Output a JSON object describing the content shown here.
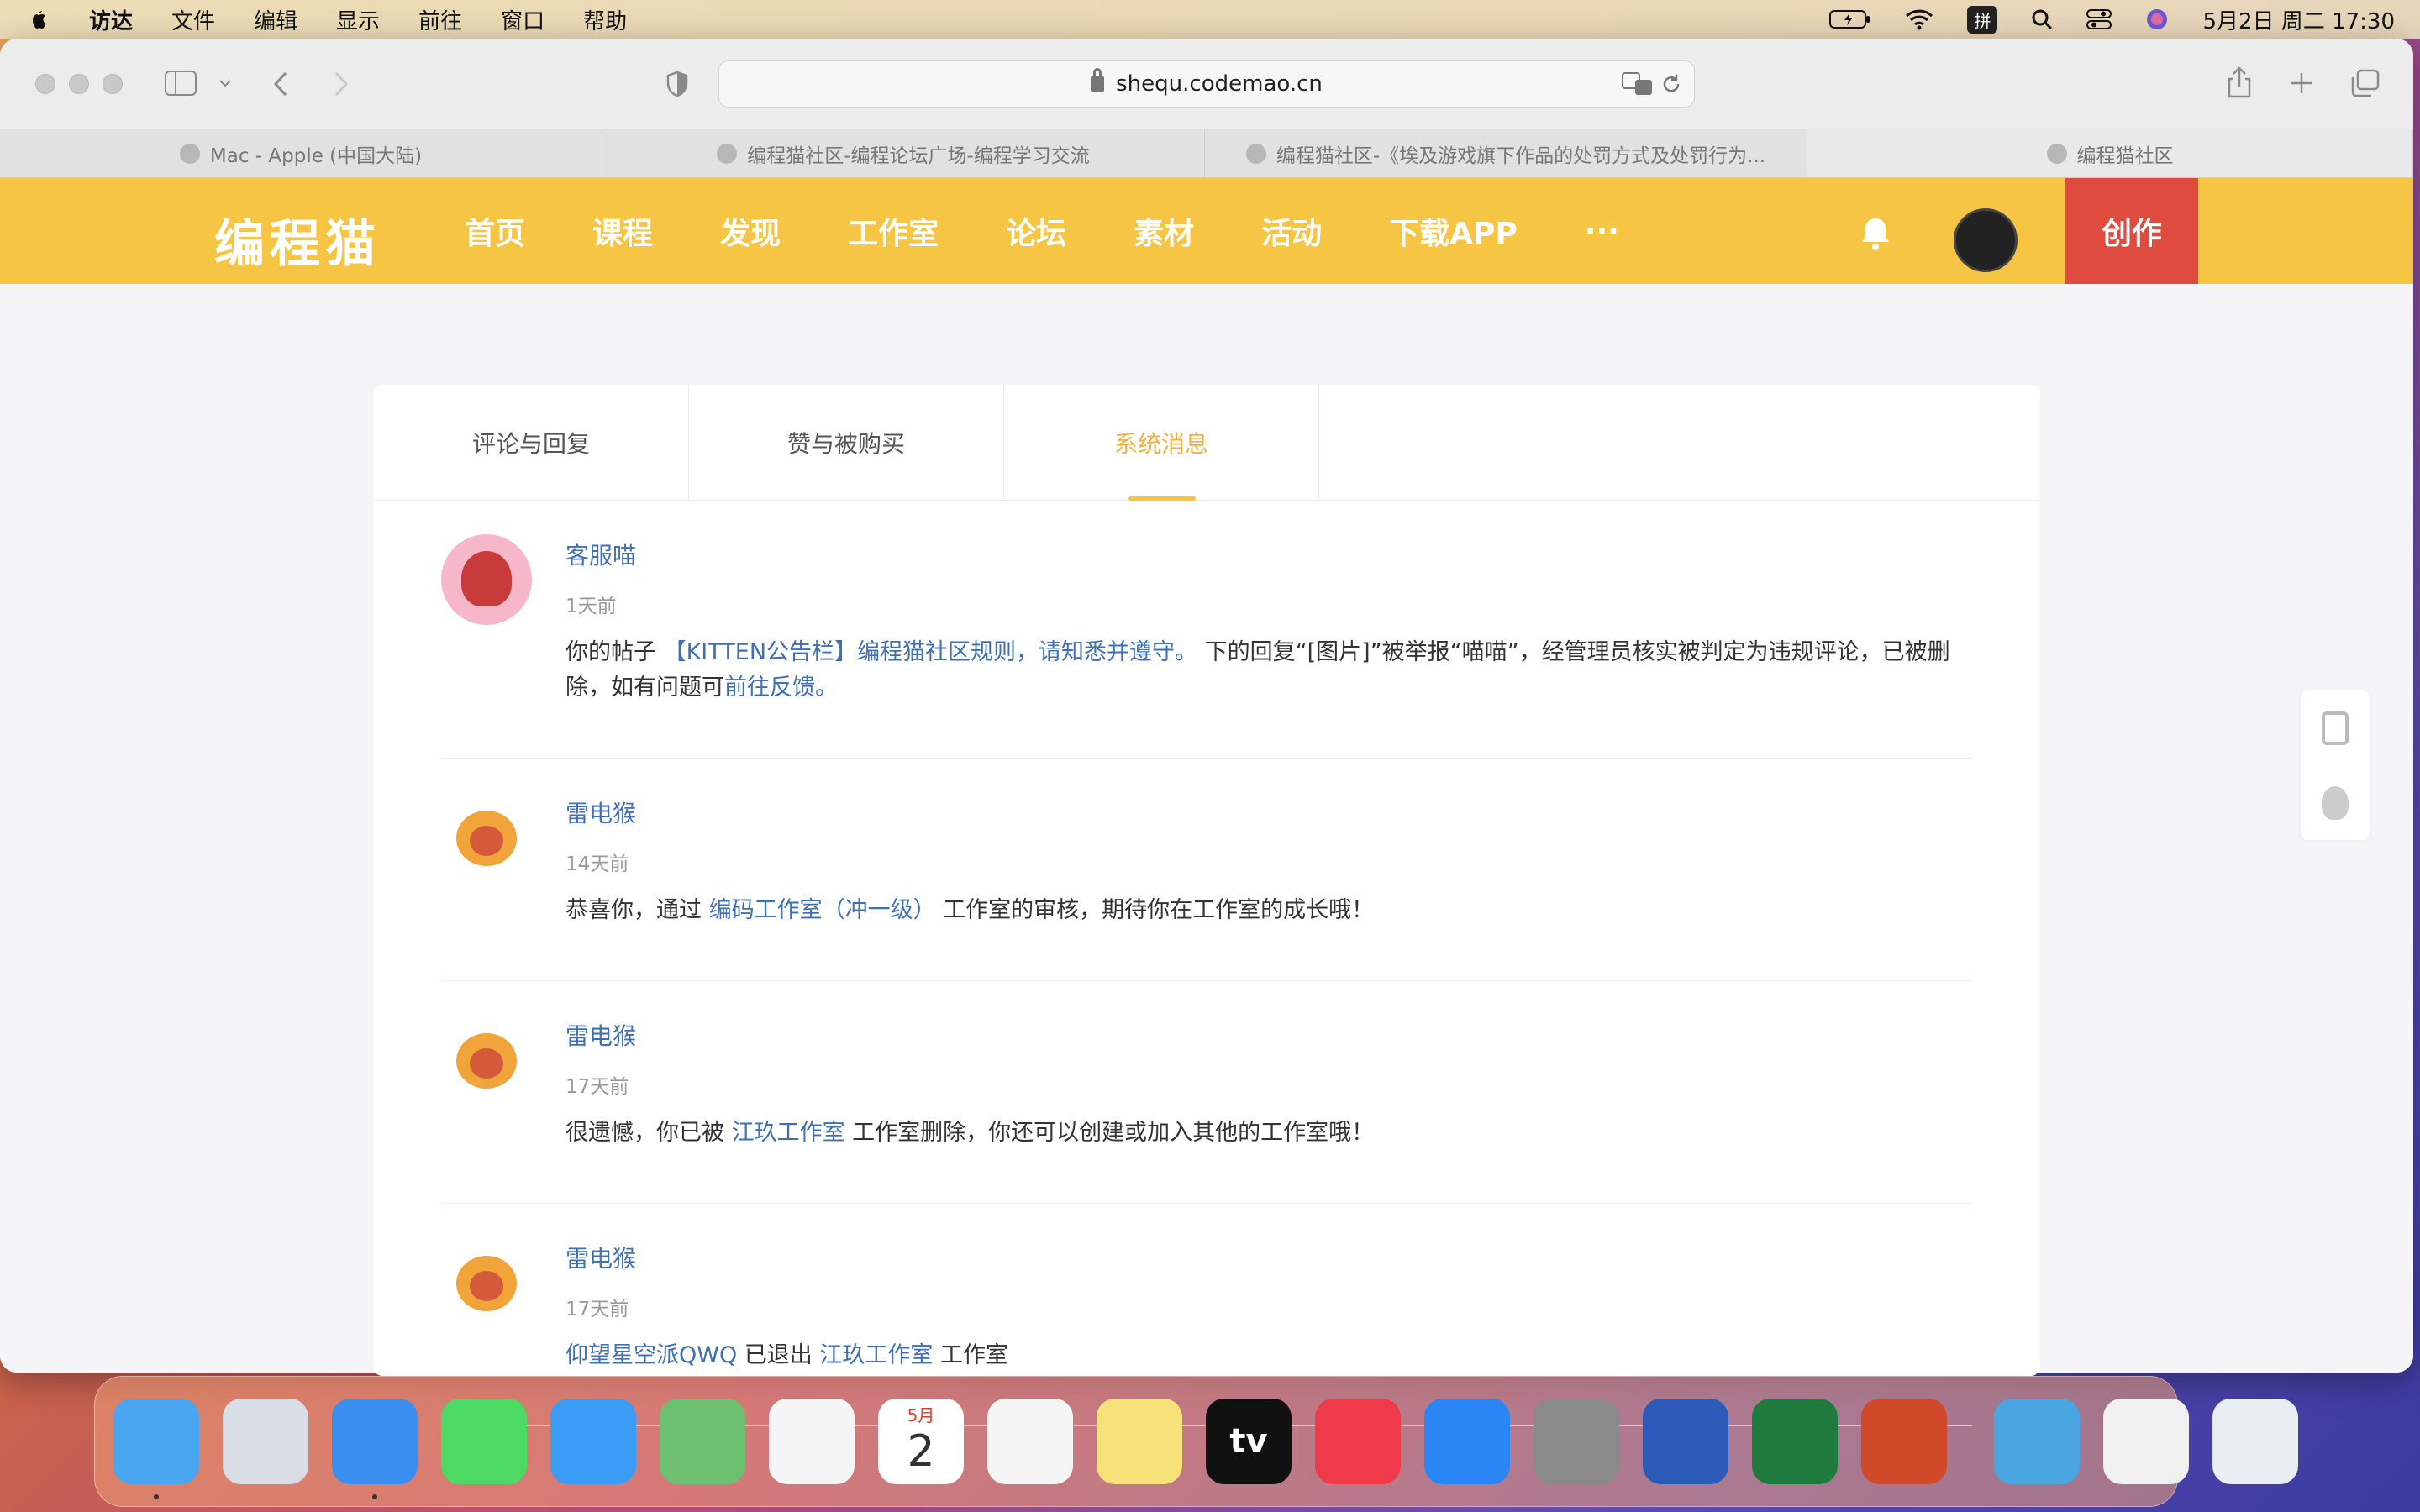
{
  "menubar": {
    "items": [
      "访达",
      "文件",
      "编辑",
      "显示",
      "前往",
      "窗口",
      "帮助"
    ],
    "ime": "拼",
    "datetime": "5月2日 周二  17:30"
  },
  "browser": {
    "url": "shequ.codemao.cn",
    "tabs": [
      {
        "title": "Mac - Apple (中国大陆)"
      },
      {
        "title": "编程猫社区-编程论坛广场-编程学习交流"
      },
      {
        "title": "编程猫社区-《埃及游戏旗下作品的处罚方式及处罚行为..."
      },
      {
        "title": "编程猫社区"
      }
    ]
  },
  "site": {
    "logo": "编程猫",
    "nav": [
      "首页",
      "课程",
      "发现",
      "工作室",
      "论坛",
      "素材",
      "活动",
      "下载APP",
      "···"
    ],
    "create_label": "创作",
    "colors": {
      "brand": "#f7c544",
      "create": "#e04b3f",
      "link": "#3f6fb5",
      "active_tab": "#f0b23d"
    }
  },
  "message_tabs": [
    "评论与回复",
    "赞与被购买",
    "系统消息"
  ],
  "messages": [
    {
      "name": "客服喵",
      "time": "1天前",
      "parts": [
        {
          "t": "你的帖子 "
        },
        {
          "t": "【KITTEN公告栏】编程猫社区规则，请知悉并遵守。",
          "link": true
        },
        {
          "t": " 下的回复“[图片]”被举报“喵喵”，经管理员核实被判定为违规评论，已被删除，如有问题可"
        },
        {
          "t": "前往反馈。",
          "link": true
        }
      ]
    },
    {
      "name": "雷电猴",
      "time": "14天前",
      "parts": [
        {
          "t": "恭喜你，通过 "
        },
        {
          "t": "编码工作室（冲一级）",
          "link": true
        },
        {
          "t": " 工作室的审核，期待你在工作室的成长哦！"
        }
      ]
    },
    {
      "name": "雷电猴",
      "time": "17天前",
      "parts": [
        {
          "t": "很遗憾，你已被 "
        },
        {
          "t": "江玖工作室",
          "link": true
        },
        {
          "t": " 工作室删除，你还可以创建或加入其他的工作室哦！"
        }
      ]
    },
    {
      "name": "雷电猴",
      "time": "17天前",
      "parts": [
        {
          "t": " "
        },
        {
          "t": "仰望星空派QWQ",
          "link": true
        },
        {
          "t": " 已退出 "
        },
        {
          "t": "江玖工作室",
          "link": true
        },
        {
          "t": " 工作室"
        }
      ]
    }
  ],
  "dock": {
    "calendar_month": "5月",
    "calendar_day": "2",
    "tv_label": "tv",
    "apps": [
      "finder-icon",
      "launchpad-icon",
      "safari-icon",
      "messages-icon",
      "mail-icon",
      "maps-icon",
      "photos-icon",
      "calendar-icon",
      "reminders-icon",
      "notes-icon",
      "appletv-icon",
      "music-icon",
      "appstore-icon",
      "settings-icon",
      "word-icon",
      "excel-icon",
      "powerpoint-icon",
      "folder-icon",
      "preview-doc-icon",
      "trash-icon"
    ]
  }
}
